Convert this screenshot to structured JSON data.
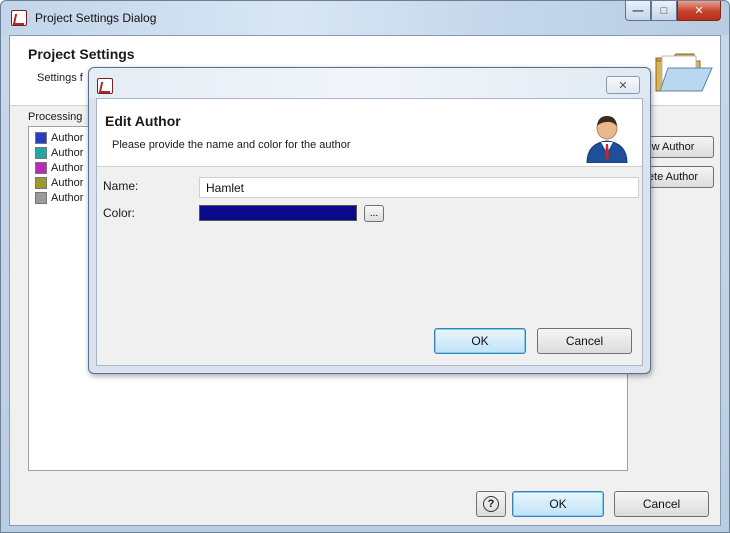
{
  "outer": {
    "window_title": "Project Settings Dialog",
    "controls": {
      "minimize": "—",
      "maximize": "□",
      "close": "✕"
    },
    "title": "Project Settings",
    "subtitle": "Settings f",
    "processing_label": "Processing",
    "authors": [
      {
        "label": "Author",
        "color": "#2a3cc4"
      },
      {
        "label": "Author",
        "color": "#1fa7a0"
      },
      {
        "label": "Author",
        "color": "#b92ab6"
      },
      {
        "label": "Author",
        "color": "#9a9a28"
      },
      {
        "label": "Author",
        "color": "#9a9a9a"
      }
    ],
    "side_buttons": {
      "new_author": "w Author",
      "delete_author": "ete Author"
    },
    "help_label": "?",
    "ok_label": "OK",
    "cancel_label": "Cancel"
  },
  "dialog": {
    "close_symbol": "✕",
    "title": "Edit Author",
    "instruction": "Please provide the name and color for the author",
    "name_label": "Name:",
    "name_value": "Hamlet",
    "color_label": "Color:",
    "color_value": "#0a0a88",
    "ellipsis_label": "...",
    "ok_label": "OK",
    "cancel_label": "Cancel"
  },
  "icons": {
    "app": "app-icon",
    "folder": "folder-icon",
    "person": "person-icon",
    "help": "help-icon"
  }
}
